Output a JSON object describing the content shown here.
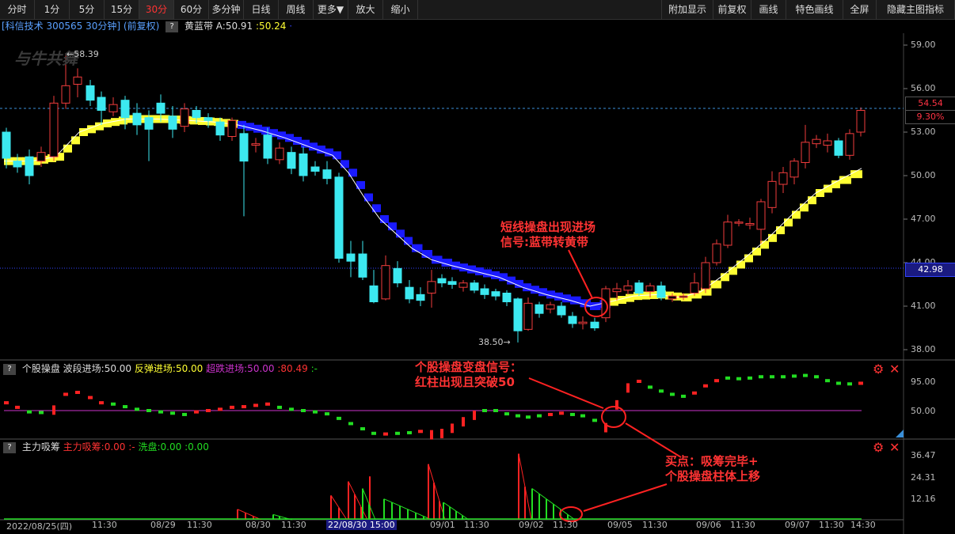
{
  "toolbar": {
    "left_tabs": [
      "分时",
      "1分",
      "5分",
      "15分",
      "30分",
      "60分",
      "多分钟",
      "日线",
      "周线",
      "更多▼",
      "放大",
      "缩小"
    ],
    "active_tab": "30分",
    "right_tabs": [
      "附加显示",
      "前复权",
      "画线",
      "特色画线",
      "全屏",
      "隐藏主图指标"
    ]
  },
  "info": {
    "stock": "[科信技术 300565 30分钟]",
    "adjust": "(前复权)",
    "q": "?",
    "indicator": "黄蓝带",
    "value_a": "A:50.91",
    "value_b": ":50.24",
    "value_dot": "·"
  },
  "watermark": "与牛共舞",
  "main": {
    "high_label": "←58.39",
    "low_label": "38.50→",
    "price_labels": [
      "59.00",
      "56.00",
      "53.00",
      "50.00",
      "47.00",
      "44.00",
      "41.00",
      "38.00"
    ],
    "current_price": "54.54",
    "current_pct": "9.30%",
    "cursor_price": "42.98"
  },
  "sub1": {
    "q": "?",
    "name": "个股操盘",
    "f1": "波段进场:50.00",
    "f2": "反弹进场:50.00",
    "f3": "超跌进场:50.00",
    "f4": ":80.49",
    "f5": ":-",
    "labels": [
      "95.00",
      "50.00"
    ]
  },
  "sub2": {
    "q": "?",
    "name": "主力吸筹",
    "f1": "主力吸筹:0.00",
    "f2": ":-",
    "f3": "洗盘:0.00",
    "f4": ":0.00",
    "labels": [
      "36.47",
      "24.31",
      "12.16"
    ]
  },
  "xaxis": [
    "2022/08/25(四)",
    "11:30",
    "08/29",
    "11:30",
    "08/30",
    "11:30",
    "22/08/30 15:00",
    "09/01",
    "11:30",
    "09/02",
    "11:30",
    "09/05",
    "11:30",
    "09/06",
    "11:30",
    "09/07",
    "11:30",
    "14:30"
  ],
  "annotations": {
    "a1": [
      "短线操盘出现进场",
      "信号:蓝带转黄带"
    ],
    "a2": [
      "个股操盘变盘信号：",
      "红柱出现且突破50"
    ],
    "a3": [
      "买点：吸筹完毕+",
      "个股操盘柱体上移"
    ]
  },
  "icons": {
    "settings": "gear-icon",
    "close": "close-icon"
  },
  "colors": {
    "up": "#f03c3c",
    "down": "#3ce8f0",
    "blue_band": "#1a1aff",
    "yellow_band": "#ffff33",
    "accent": "#ff3333",
    "purple": "#cc33cc",
    "green": "#22dd22"
  }
}
